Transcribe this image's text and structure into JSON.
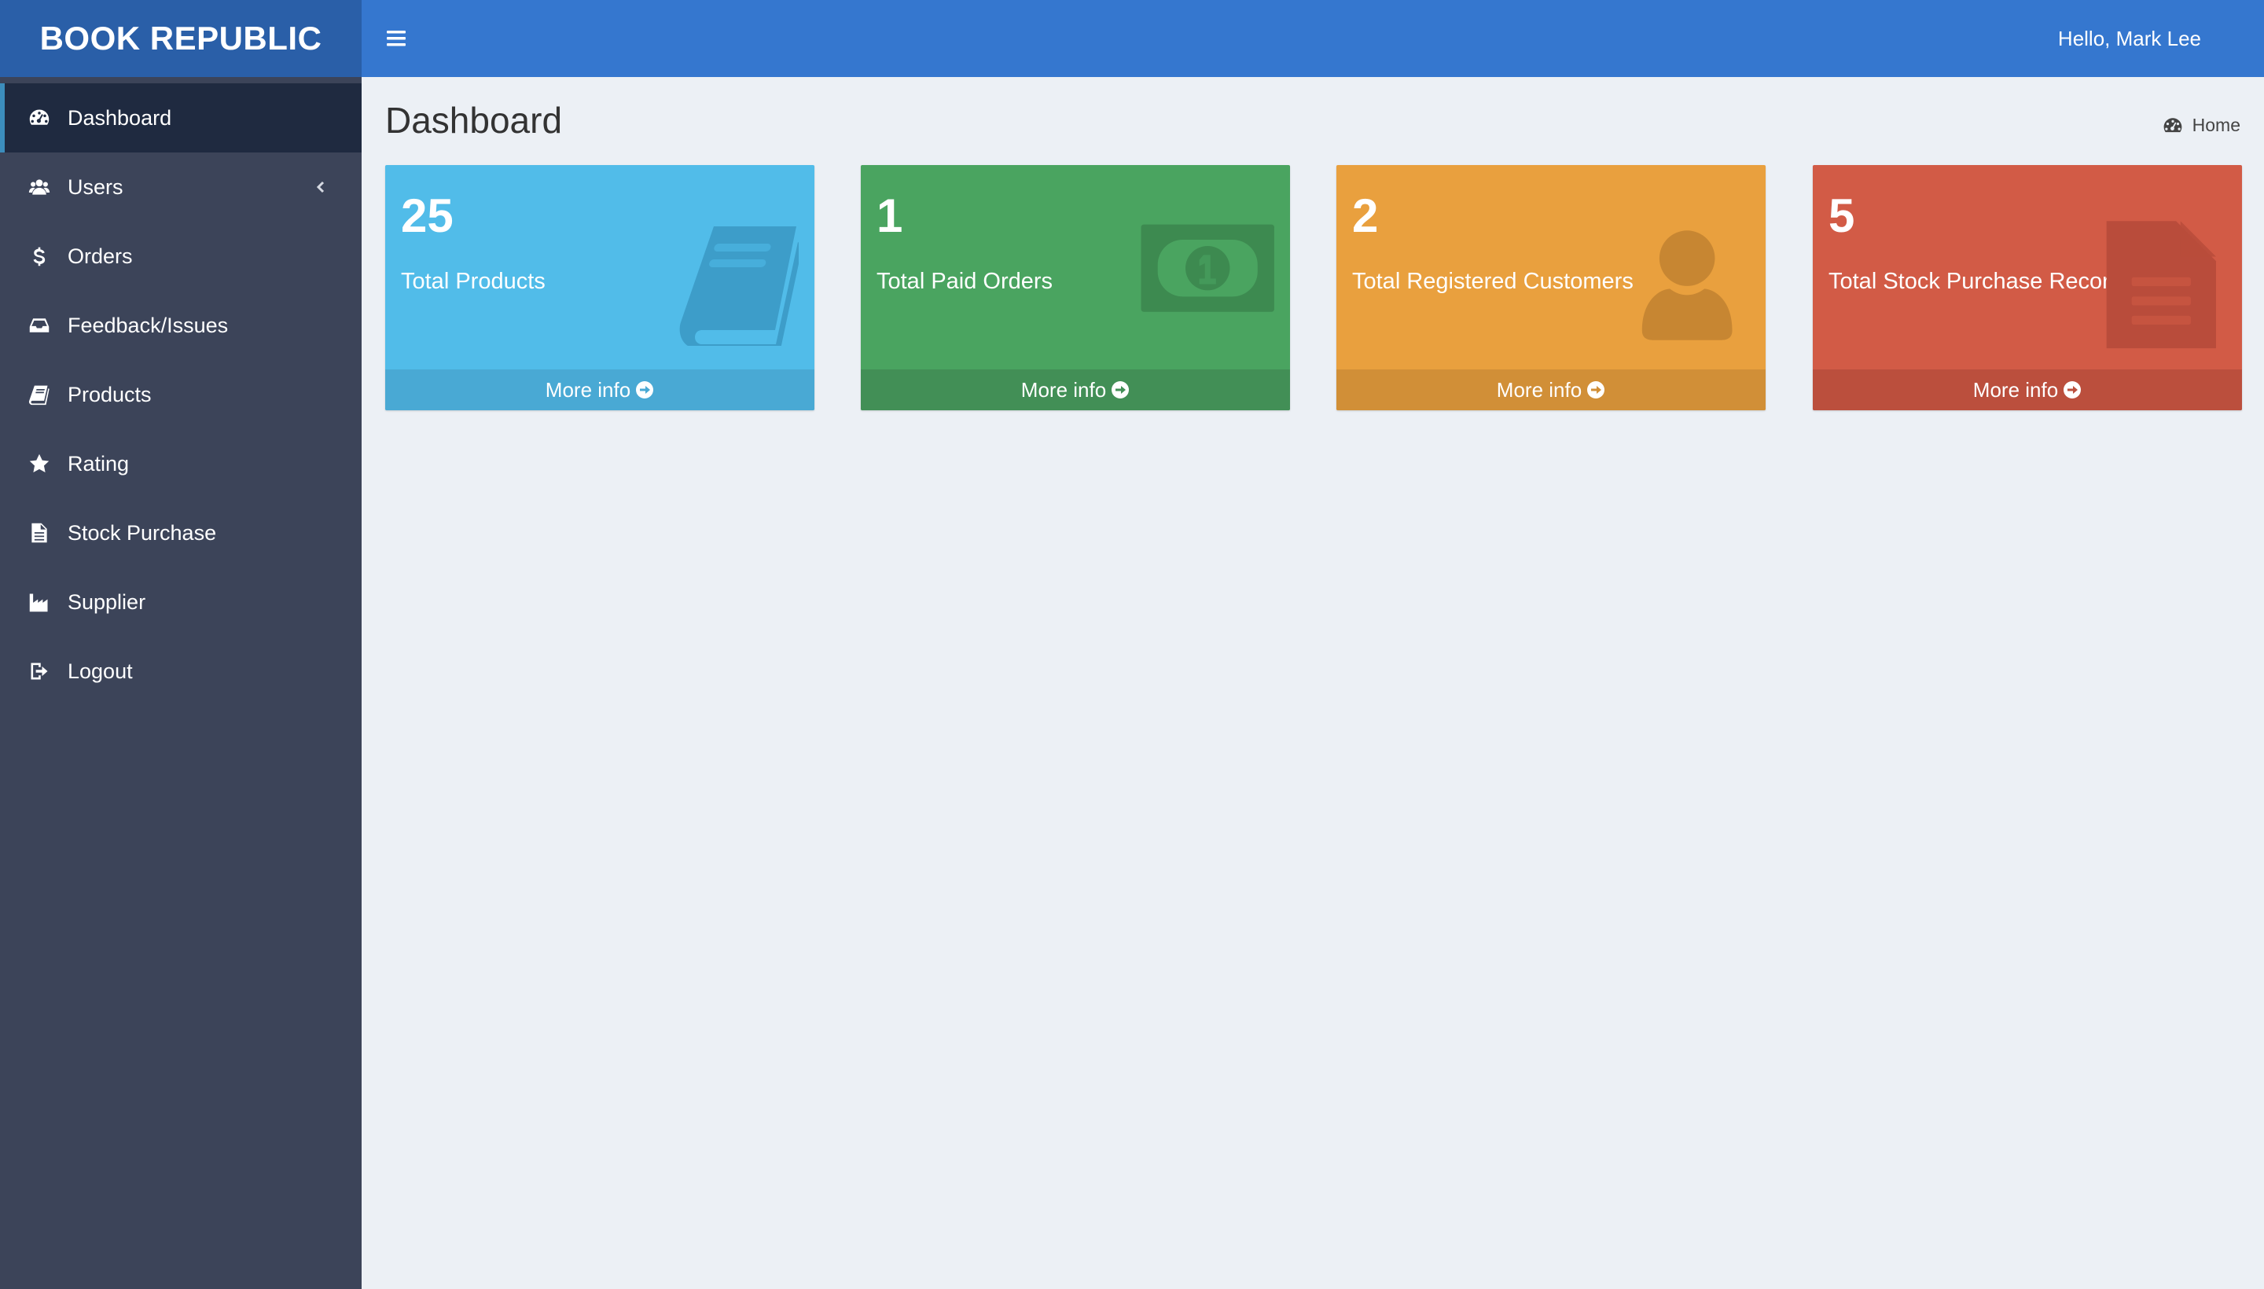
{
  "brand": {
    "name": "BOOK REPUBLIC"
  },
  "header": {
    "greeting": "Hello, Mark Lee",
    "menu_toggle_icon": "hamburger-icon"
  },
  "sidebar": {
    "items": [
      {
        "label": "Dashboard",
        "icon": "dashboard-icon",
        "active": true
      },
      {
        "label": "Users",
        "icon": "users-icon",
        "has_submenu": true
      },
      {
        "label": "Orders",
        "icon": "dollar-icon"
      },
      {
        "label": "Feedback/Issues",
        "icon": "inbox-icon"
      },
      {
        "label": "Products",
        "icon": "book-icon"
      },
      {
        "label": "Rating",
        "icon": "star-icon"
      },
      {
        "label": "Stock Purchase",
        "icon": "file-icon"
      },
      {
        "label": "Supplier",
        "icon": "industry-icon"
      },
      {
        "label": "Logout",
        "icon": "sign-out-icon"
      }
    ]
  },
  "page": {
    "title": "Dashboard",
    "breadcrumb": {
      "label": "Home",
      "icon": "dashboard-icon"
    }
  },
  "stats": [
    {
      "count": "25",
      "label": "Total Products",
      "link": "More info",
      "icon": "book-icon",
      "color": "#51bce9"
    },
    {
      "count": "1",
      "label": "Total Paid Orders",
      "link": "More info",
      "icon": "money-icon",
      "color": "#4aa460"
    },
    {
      "count": "2",
      "label": "Total Registered Customers",
      "link": "More info",
      "icon": "user-icon",
      "color": "#e9a03e"
    },
    {
      "count": "5",
      "label": "Total Stock Purchase Records",
      "link": "More info",
      "icon": "file-text-icon",
      "color": "#d25b46"
    }
  ],
  "colors": {
    "sidebar_bg": "#3c4459",
    "sidebar_active_bg": "#1f2a40",
    "logo_bg": "#2a5fa8",
    "header_bg": "#3577cf",
    "content_bg": "#ecf0f5"
  }
}
